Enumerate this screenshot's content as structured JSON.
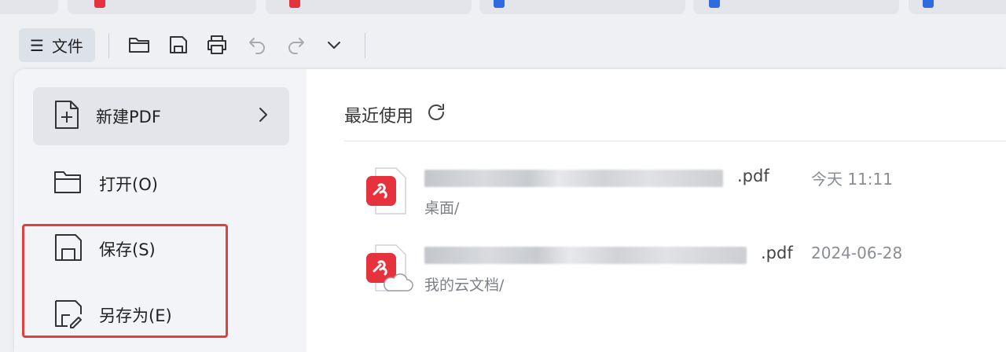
{
  "toolbar": {
    "file_label": "文件",
    "menu_glyph": "☰"
  },
  "menu": {
    "items": [
      {
        "label": "新建PDF"
      },
      {
        "label": "打开(O)"
      },
      {
        "label": "保存(S)"
      },
      {
        "label": "另存为(E)"
      }
    ]
  },
  "recent": {
    "title": "最近使用",
    "files": [
      {
        "ext": ".pdf",
        "date": "今天 11:11",
        "path": "桌面/"
      },
      {
        "ext": ".pdf",
        "date": "2024-06-28",
        "path": "我的云文档/"
      }
    ]
  },
  "colors": {
    "accent_red": "#e5323c",
    "highlight": "#e0413f"
  }
}
